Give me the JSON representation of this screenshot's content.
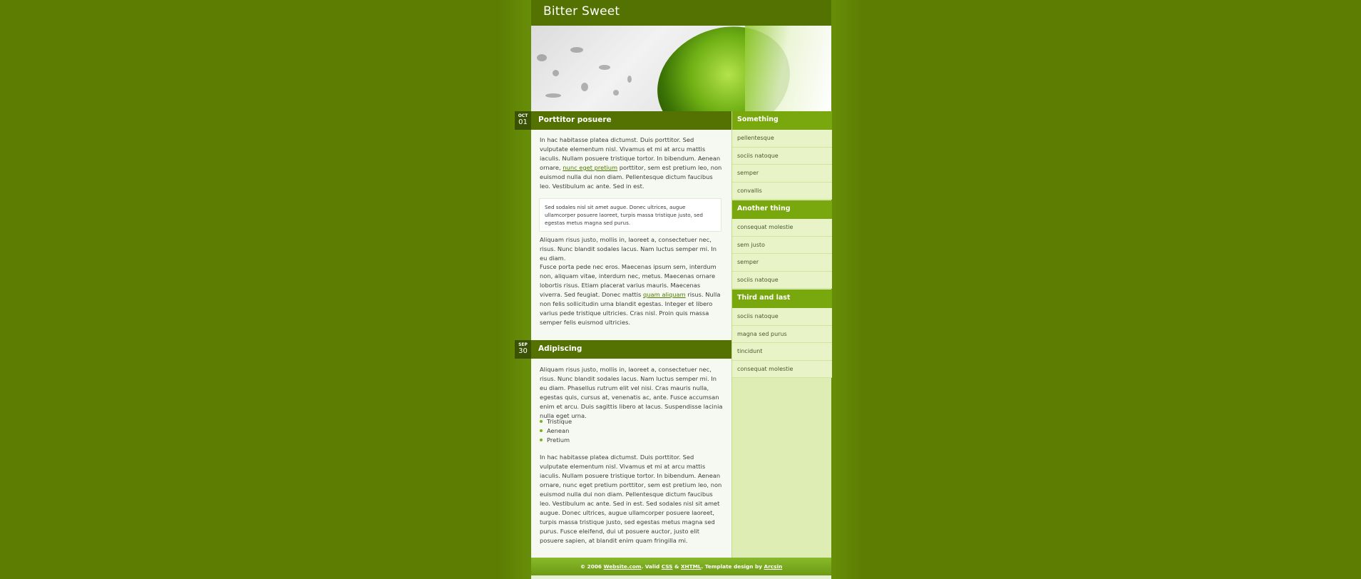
{
  "site": {
    "title": "Bitter Sweet"
  },
  "posts": [
    {
      "month": "OCT",
      "day": "01",
      "title": "Porttitor posuere",
      "p1_a": "In hac habitasse platea dictumst. Duis porttitor. Sed vulputate elementum nisl. Vivamus et mi at arcu mattis iaculis. Nullam posuere tristique tortor. In bibendum. Aenean ornare,",
      "p1_link": "nunc eget pretium",
      "p1_b": "porttitor, sem est pretium leo, non euismod nulla dui non diam. Pellentesque dictum faucibus leo. Vestibulum ac ante. Sed in est.",
      "quote": "Sed sodales nisl sit amet augue. Donec ultrices, augue ullamcorper posuere laoreet, turpis massa tristique justo, sed egestas metus magna sed purus.",
      "p2": "Aliquam risus justo, mollis in, laoreet a, consectetuer nec, risus. Nunc blandit sodales lacus. Nam luctus semper mi. In eu diam.",
      "p3_a": "Fusce porta pede nec eros. Maecenas ipsum sem, interdum non, aliquam vitae, interdum nec, metus. Maecenas ornare lobortis risus. Etiam placerat varius mauris. Maecenas viverra. Sed feugiat. Donec mattis",
      "p3_link": "quam aliquam",
      "p3_b": "risus. Nulla non felis sollicitudin urna blandit egestas. Integer et libero varius pede tristique ultricies. Cras nisl. Proin quis massa semper felis euismod ultricies."
    },
    {
      "month": "SEP",
      "day": "30",
      "title": "Adipiscing",
      "p1": "Aliquam risus justo, mollis in, laoreet a, consectetuer nec, risus. Nunc blandit sodales lacus. Nam luctus semper mi. In eu diam. Phasellus rutrum elit vel nisi. Cras mauris nulla, egestas quis, cursus at, venenatis ac, ante. Fusce accumsan enim et arcu. Duis sagittis libero at lacus. Suspendisse lacinia nulla eget urna.",
      "bullets": [
        "Tristique",
        "Aenean",
        "Pretium"
      ],
      "p2": "In hac habitasse platea dictumst. Duis porttitor. Sed vulputate elementum nisl. Vivamus et mi at arcu mattis iaculis. Nullam posuere tristique tortor. In bibendum. Aenean ornare, nunc eget pretium porttitor, sem est pretium leo, non euismod nulla dui non diam. Pellentesque dictum faucibus leo. Vestibulum ac ante. Sed in est. Sed sodales nisl sit amet augue. Donec ultrices, augue ullamcorper posuere laoreet, turpis massa tristique justo, sed egestas metus magna sed purus. Fusce eleifend, dui ut posuere auctor, justo elit posuere sapien, at blandit enim quam fringilla mi."
    }
  ],
  "sidebar": [
    {
      "heading": "Something",
      "items": [
        "pellentesque",
        "sociis natoque",
        "semper",
        "convallis"
      ]
    },
    {
      "heading": "Another thing",
      "items": [
        "consequat molestie",
        "sem justo",
        "semper",
        "sociis natoque"
      ]
    },
    {
      "heading": "Third and last",
      "items": [
        "sociis natoque",
        "magna sed purus",
        "tincidunt",
        "consequat molestie"
      ]
    }
  ],
  "footer": {
    "copyright": "© 2006",
    "site_link": "Website.com",
    "valid": ". Valid",
    "css": "CSS",
    "amp": "&",
    "xhtml": "XHTML",
    "design": ". Template design by",
    "author": "Arcsin"
  },
  "colors": {
    "background": "#5d7d02",
    "title_bar": "#547202",
    "accent": "#78a80d"
  }
}
